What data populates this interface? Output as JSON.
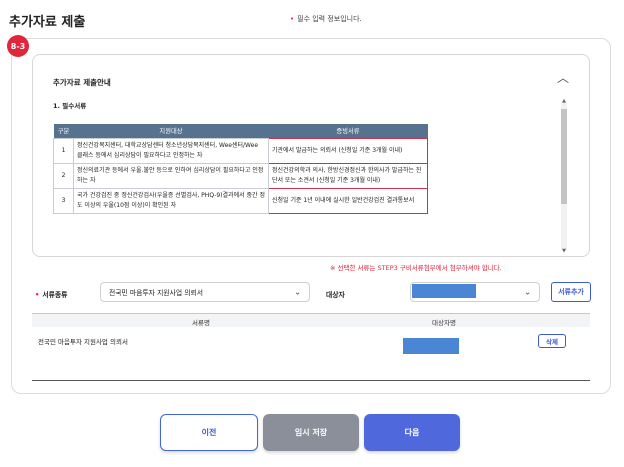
{
  "header": {
    "title": "추가자료 제출",
    "required_note": "필수 입력 정보입니다.",
    "required_mark": "•"
  },
  "step_badge": "8-3",
  "info": {
    "title": "추가자료 제출안내",
    "section_heading": "1. 필수서류",
    "table": {
      "headers": [
        "구분",
        "지원대상",
        "증빙서류"
      ],
      "rows": [
        {
          "no": "1",
          "target": "정신건강복지센터, 대학교상담센터 청소년상담복지센터, Wee센터/Wee 클래스 등에서 심리상담이 필요하다고 인정하는 자",
          "docs": "기관에서 발급하는 의뢰서 (신청일 기준 3개월 이내)"
        },
        {
          "no": "2",
          "target": "정신의료기관 등에서 우울.불안 등으로 인하여 심리상담이 필요하다고 인정하는 자",
          "docs": "정신건강의학과 의사, 한방신경정신과 한의사가 발급하는 진단서 또는 소견서 (신청일 기준 3개월 이내)"
        },
        {
          "no": "3",
          "target": "국가 건강검진 중 정신건강검사(우울증 선별검사, PHQ-9)결과에서 중간 정도 이상의 우울(10점 이상)이 확인된 자",
          "docs": "신청일 기준 1년 이내에 실시한 일반건강검진 결과통보서"
        }
      ]
    }
  },
  "warning": "※ 선택한 서류는 STEP3 구비서류첨부에서 첨부하셔야 합니다.",
  "form": {
    "doc_type_label": "서류종류",
    "doc_type_value": "전국민 마음투자 지원사업 의뢰서",
    "target_label": "대상자",
    "add_button": "서류추가"
  },
  "list": {
    "col_doc": "서류명",
    "col_target": "대상자명",
    "rows": [
      {
        "doc": "전국민 마음투자 지원사업 의뢰서",
        "delete": "삭제"
      }
    ]
  },
  "buttons": {
    "prev": "이전",
    "save": "임시 저장",
    "next": "다음"
  },
  "colors": {
    "accent": "#4f69dd",
    "required": "#e0263b",
    "table_header": "#56728e",
    "masked": "#4a86d4"
  }
}
